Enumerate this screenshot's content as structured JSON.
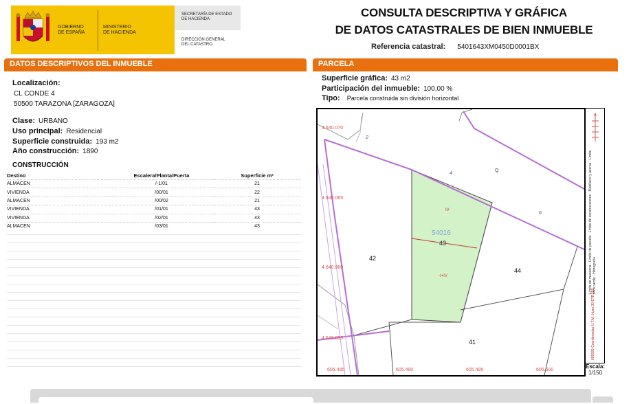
{
  "header": {
    "gov_line1": "GOBIERNO",
    "gov_line2": "DE ESPAÑA",
    "ministry_line1": "MINISTERIO",
    "ministry_line2": "DE HACIENDA",
    "secretaria_line1": "SECRETARÍA DE ESTADO",
    "secretaria_line2": "DE HACIENDA",
    "direccion_line1": "DIRECCIÓN GENERAL",
    "direccion_line2": "DEL CATASTRO",
    "title_line1": "CONSULTA DESCRIPTIVA Y GRÁFICA",
    "title_line2": "DE DATOS CATASTRALES DE BIEN INMUEBLE",
    "ref_label": "Referencia catastral:",
    "ref_value": "5401643XM0450D0001BX"
  },
  "datos": {
    "heading": "DATOS DESCRIPTIVOS DEL INMUEBLE",
    "localizacion_label": "Localización:",
    "localizacion_line1": "CL CONDE 4",
    "localizacion_line2": "50500 TARAZONA [ZARAGOZA]",
    "clase_label": "Clase:",
    "clase_value": "URBANO",
    "uso_label": "Uso principal:",
    "uso_value": "Residencial",
    "superficie_label": "Superficie construida:",
    "superficie_value": "193 m2",
    "anio_label": "Año construcción:",
    "anio_value": "1890"
  },
  "construccion": {
    "heading": "CONSTRUCCIÓN",
    "columns": [
      "Destino",
      "Escalera/Planta/Puerta",
      "Superficie m²"
    ],
    "rows": [
      [
        "ALMACEN",
        "/-1/01",
        "21"
      ],
      [
        "VIVIENDA",
        "/00/01",
        "22"
      ],
      [
        "ALMACEN",
        "/00/02",
        "21"
      ],
      [
        "VIVIENDA",
        "/01/01",
        "43"
      ],
      [
        "VIVIENDA",
        "/02/01",
        "43"
      ],
      [
        "ALMACEN",
        "/03/01",
        "43"
      ]
    ]
  },
  "parcela": {
    "heading": "PARCELA",
    "superficie_label": "Superficie gráfica:",
    "superficie_value": "43 m2",
    "participacion_label": "Participación del inmueble:",
    "participacion_value": "100,00 %",
    "tipo_label": "Tipo:",
    "tipo_value": "Parcela construida sin división horizontal"
  },
  "map": {
    "y_coords": [
      "4.640.070",
      "4.640.065",
      "4.640.060",
      "4.640.055"
    ],
    "x_coords": [
      "605.485",
      "605.490",
      "605.495",
      "605.500"
    ],
    "parcel_id": "54016",
    "parcel_number": "43",
    "floor_upper": "IV",
    "floor_lower": "-I+IV",
    "neighbors": [
      "42",
      "44",
      "41"
    ],
    "street_numbers": [
      "2",
      "4",
      "6"
    ],
    "street_mark": "Q",
    "escala_label": "Escala:",
    "escala_value": "1/150",
    "legend": [
      "Límite de manzana",
      "Límite de parcela",
      "Límite de construcciones",
      "Mobiliario y aceras",
      "Límite zona verde",
      "Hidrografía"
    ],
    "coords_note": "605595 Coordenadas U.T.M. Huso 30 ETRS89",
    "colors": {
      "parcel_fill": "#d4f2c8",
      "boundary": "#b66bd6",
      "coord_text": "#d9534f",
      "header_orange": "#e8700e",
      "gov_yellow": "#f5c400"
    }
  }
}
